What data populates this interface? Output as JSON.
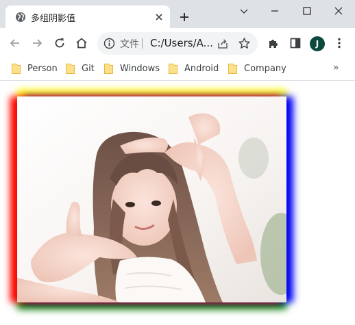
{
  "tab": {
    "title": "多组阴影值"
  },
  "toolbar": {
    "file_label": "文件",
    "url": "C:/Users/A..."
  },
  "avatar": {
    "initial": "J",
    "color": "#0d4a3d"
  },
  "bookmarks": [
    {
      "label": "Person"
    },
    {
      "label": "Git"
    },
    {
      "label": "Windows"
    },
    {
      "label": "Android"
    },
    {
      "label": "Company"
    }
  ],
  "bookmarks_overflow": "»",
  "shadow_colors": {
    "left": "#ff0000",
    "right": "#0000ff",
    "top": "#ffff00",
    "bottom": "#008000"
  },
  "icons": {
    "tab": "globe-icon",
    "close": "close-icon",
    "new_tab": "plus-icon",
    "back": "back-arrow-icon",
    "forward": "forward-arrow-icon",
    "reload": "reload-icon",
    "home": "home-icon",
    "info": "info-icon",
    "share": "share-icon",
    "bookmark": "star-icon",
    "extensions": "puzzle-icon",
    "side_panel": "side-panel-icon",
    "menu": "kebab-menu-icon"
  }
}
